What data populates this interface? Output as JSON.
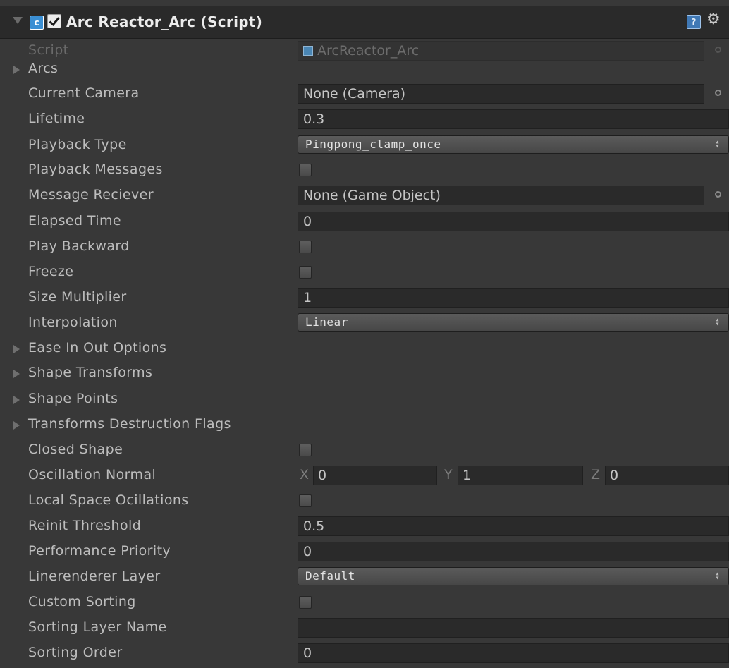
{
  "header": {
    "title": "Arc Reactor_Arc (Script)",
    "script_icon_name": "script-file-icon",
    "enabled": true
  },
  "script_row": {
    "label": "Script",
    "value": "ArcReactor_Arc"
  },
  "foldouts": {
    "arcs": "Arcs",
    "ease": "Ease In Out Options",
    "shape_transforms": "Shape Transforms",
    "shape_points": "Shape Points",
    "destruction_flags": "Transforms Destruction Flags"
  },
  "fields": {
    "current_camera": {
      "label": "Current Camera",
      "value": "None (Camera)"
    },
    "lifetime": {
      "label": "Lifetime",
      "value": "0.3"
    },
    "playback_type": {
      "label": "Playback Type",
      "value": "Pingpong_clamp_once"
    },
    "playback_messages": {
      "label": "Playback Messages",
      "checked": false
    },
    "message_reciever": {
      "label": "Message Reciever",
      "value": "None (Game Object)"
    },
    "elapsed_time": {
      "label": "Elapsed Time",
      "value": "0"
    },
    "play_backward": {
      "label": "Play Backward",
      "checked": false
    },
    "freeze": {
      "label": "Freeze",
      "checked": false
    },
    "size_multiplier": {
      "label": "Size Multiplier",
      "value": "1"
    },
    "interpolation": {
      "label": "Interpolation",
      "value": "Linear"
    },
    "closed_shape": {
      "label": "Closed Shape",
      "checked": false
    },
    "oscillation_normal": {
      "label": "Oscillation Normal",
      "x_label": "X",
      "x": "0",
      "y_label": "Y",
      "y": "1",
      "z_label": "Z",
      "z": "0"
    },
    "local_space": {
      "label": "Local Space Ocillations",
      "checked": false
    },
    "reinit_threshold": {
      "label": "Reinit Threshold",
      "value": "0.5"
    },
    "performance_priority": {
      "label": "Performance Priority",
      "value": "0"
    },
    "linerenderer_layer": {
      "label": "Linerenderer Layer",
      "value": "Default"
    },
    "custom_sorting": {
      "label": "Custom Sorting",
      "checked": false
    },
    "sorting_layer_name": {
      "label": "Sorting Layer Name",
      "value": ""
    },
    "sorting_order": {
      "label": "Sorting Order",
      "value": "0"
    }
  }
}
